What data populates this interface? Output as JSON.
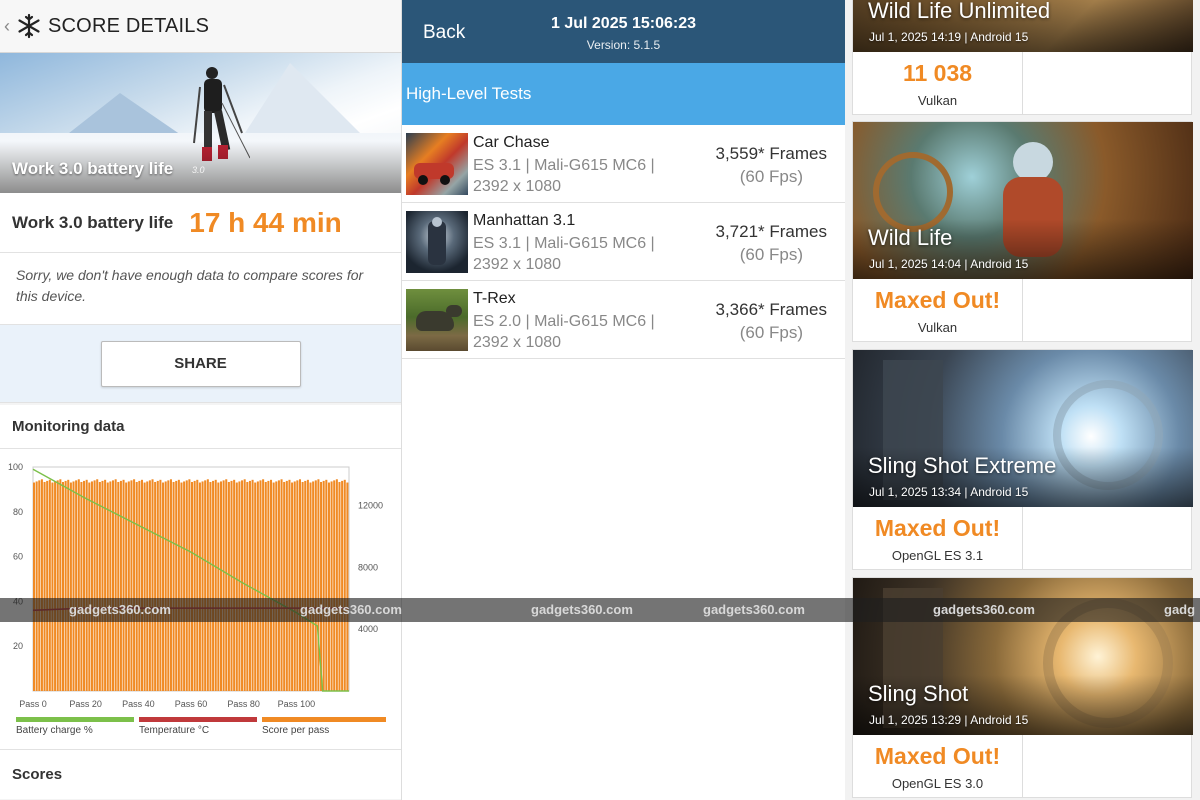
{
  "left": {
    "header_title": "SCORE DETAILS",
    "hero_label": "Work 3.0 battery life",
    "hero_version": "3.0",
    "score_label": "Work 3.0 battery life",
    "score_value": "17 h 44 min",
    "sorry_text": "Sorry, we don't have enough data to compare scores for this device.",
    "share_label": "SHARE",
    "monitoring_title": "Monitoring data",
    "scores_title": "Scores",
    "legend": [
      {
        "label": "Battery charge %",
        "color": "#7cc04a"
      },
      {
        "label": "Temperature °C",
        "color": "#c0393b"
      },
      {
        "label": "Score per pass",
        "color": "#f08a24"
      }
    ]
  },
  "chart_data": {
    "type": "bar",
    "title": "",
    "x_ticks": [
      "Pass 0",
      "Pass 20",
      "Pass 40",
      "Pass 60",
      "Pass 80",
      "Pass 100"
    ],
    "y_left_ticks": [
      "20",
      "40",
      "60",
      "80",
      "100"
    ],
    "y_right_ticks": [
      "4000",
      "8000",
      "12000"
    ],
    "y_left_range": [
      0,
      100
    ],
    "y_right_range": [
      0,
      14500
    ],
    "bar_count": 120,
    "score_per_pass_level": 13600,
    "series": [
      {
        "name": "Battery charge %",
        "color": "#7cc04a",
        "x": [
          0,
          20,
          40,
          60,
          80,
          100,
          108,
          110,
          120
        ],
        "y": [
          99,
          86,
          74,
          62,
          48,
          35,
          29,
          0,
          0
        ]
      },
      {
        "name": "Temperature °C",
        "color": "#c0393b",
        "x": [
          0,
          20,
          40,
          60,
          80,
          100,
          108,
          110,
          120
        ],
        "y": [
          36,
          37,
          37,
          37,
          37,
          37,
          37,
          37,
          37
        ]
      }
    ]
  },
  "mid": {
    "back_label": "Back",
    "date": "1 Jul 2025 15:06:23",
    "version": "Version: 5.1.5",
    "section_title": "High-Level Tests",
    "tests": [
      {
        "name": "Car Chase",
        "spec1": "ES 3.1 | Mali-G615 MC6 |",
        "spec2": "2392 x 1080",
        "frames": "3,559* Frames",
        "fps": "(60 Fps)"
      },
      {
        "name": "Manhattan 3.1",
        "spec1": "ES 3.1 | Mali-G615 MC6 |",
        "spec2": "2392 x 1080",
        "frames": "3,721* Frames",
        "fps": "(60 Fps)"
      },
      {
        "name": "T-Rex",
        "spec1": "ES 2.0 | Mali-G615 MC6 |",
        "spec2": "2392 x 1080",
        "frames": "3,366* Frames",
        "fps": "(60 Fps)"
      }
    ]
  },
  "right": {
    "cards": [
      {
        "name": "Wild Life Unlimited",
        "date": "Jul 1, 2025 14:19 | Android 15",
        "score": "11 038",
        "api": "Vulkan"
      },
      {
        "name": "Wild Life",
        "date": "Jul 1, 2025 14:04 | Android 15",
        "score": "Maxed Out!",
        "api": "Vulkan"
      },
      {
        "name": "Sling Shot Extreme",
        "date": "Jul 1, 2025 13:34 | Android 15",
        "score": "Maxed Out!",
        "api": "OpenGL ES 3.1"
      },
      {
        "name": "Sling Shot",
        "date": "Jul 1, 2025 13:29 | Android 15",
        "score": "Maxed Out!",
        "api": "OpenGL ES 3.0"
      }
    ]
  },
  "watermark": {
    "text": "gadgets360.com",
    "partial": "gadg"
  },
  "colors": {
    "accent_orange": "#f08a24",
    "header_blue": "#2b5678",
    "section_blue": "#4aa8e6"
  }
}
